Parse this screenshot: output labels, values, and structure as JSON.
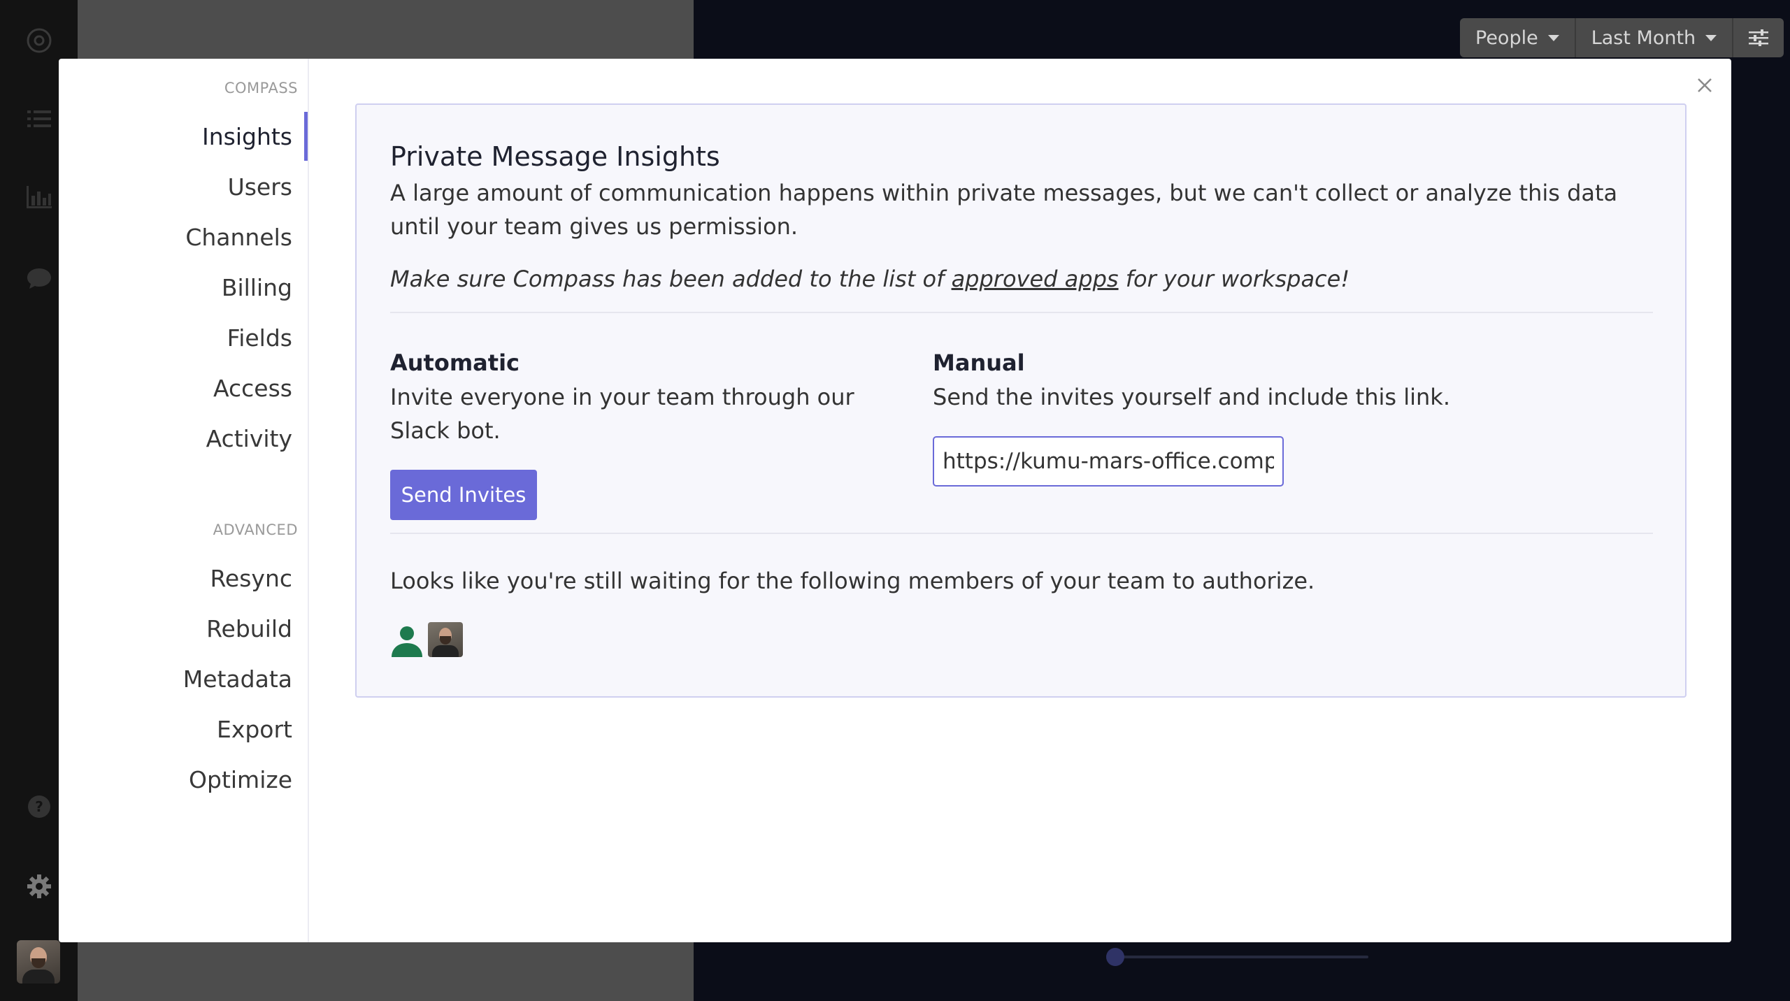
{
  "toolbar": {
    "people_label": "People",
    "period_label": "Last Month"
  },
  "nav": {
    "section_compass": "COMPASS",
    "section_advanced": "ADVANCED",
    "items": [
      {
        "label": "Insights"
      },
      {
        "label": "Users"
      },
      {
        "label": "Channels"
      },
      {
        "label": "Billing"
      },
      {
        "label": "Fields"
      },
      {
        "label": "Access"
      },
      {
        "label": "Activity"
      }
    ],
    "advanced_items": [
      {
        "label": "Resync"
      },
      {
        "label": "Rebuild"
      },
      {
        "label": "Metadata"
      },
      {
        "label": "Export"
      },
      {
        "label": "Optimize"
      }
    ],
    "active": "Insights"
  },
  "card": {
    "title": "Private Message Insights",
    "lead": "A large amount of communication happens within private messages, but we can't collect or analyze this data until your team gives us permission.",
    "note_pre": "Make sure Compass has been added to the list of ",
    "note_link": "approved apps",
    "note_post": " for your workspace!",
    "automatic": {
      "title": "Automatic",
      "text": "Invite everyone in your team through our Slack bot.",
      "button": "Send Invites"
    },
    "manual": {
      "title": "Manual",
      "text": "Send the invites yourself and include this link.",
      "link_value": "https://kumu-mars-office.compas"
    },
    "waiting_text": "Looks like you're still waiting for the following members of your team to authorize."
  },
  "colors": {
    "accent": "#6a6ad8",
    "card_border": "#cfcff0",
    "avatar_green": "#1e7a4e"
  }
}
